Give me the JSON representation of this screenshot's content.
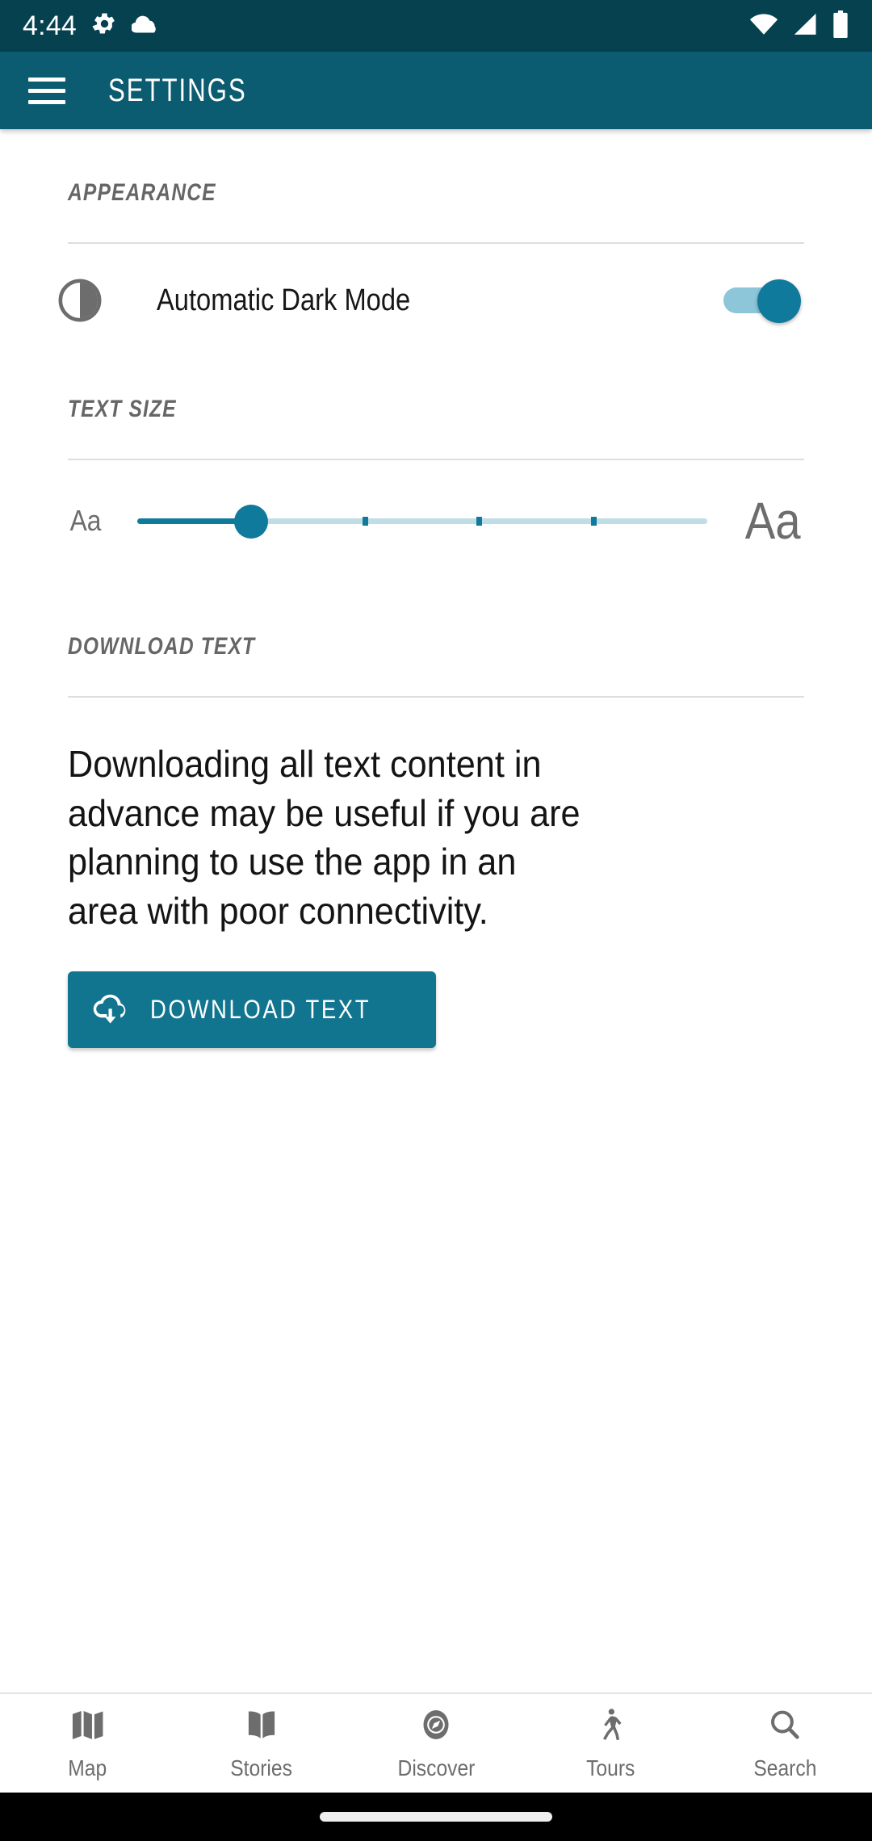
{
  "status_bar": {
    "time": "4:44",
    "left_icons": [
      "gear-icon",
      "cloud-icon"
    ],
    "right_icons": [
      "wifi-icon",
      "cellular-signal-icon",
      "battery-icon"
    ],
    "background_color": "#06414f"
  },
  "app_bar": {
    "menu_icon": "hamburger-menu-icon",
    "title": "SETTINGS",
    "background_color": "#0b5c70",
    "text_color": "#ffffff"
  },
  "sections": {
    "appearance": {
      "heading": "APPEARANCE",
      "dark_mode": {
        "icon": "contrast-icon",
        "label": "Automatic Dark Mode",
        "enabled": true,
        "track_color": "#8dc6d8",
        "thumb_color": "#0f7a9b"
      }
    },
    "text_size": {
      "heading": "TEXT SIZE",
      "min_label": "Aa",
      "max_label": "Aa",
      "value": 1,
      "min": 0,
      "max": 5,
      "steps": 6,
      "active_color": "#0f7a9b",
      "rail_color": "#bfdde6"
    },
    "download_text": {
      "heading": "DOWNLOAD TEXT",
      "description": "Downloading all text content in advance may be useful if you are planning to use the app in an area with poor connectivity.",
      "button": {
        "icon": "cloud-download-icon",
        "label": "DOWNLOAD TEXT",
        "background_color": "#12758f"
      }
    }
  },
  "bottom_nav": {
    "items": [
      {
        "icon": "map-icon",
        "label": "Map",
        "active": false
      },
      {
        "icon": "book-icon",
        "label": "Stories",
        "active": false
      },
      {
        "icon": "compass-icon",
        "label": "Discover",
        "active": false
      },
      {
        "icon": "walking-person-icon",
        "label": "Tours",
        "active": false
      },
      {
        "icon": "search-icon",
        "label": "Search",
        "active": false
      }
    ],
    "inactive_color": "#6d6d6d"
  }
}
